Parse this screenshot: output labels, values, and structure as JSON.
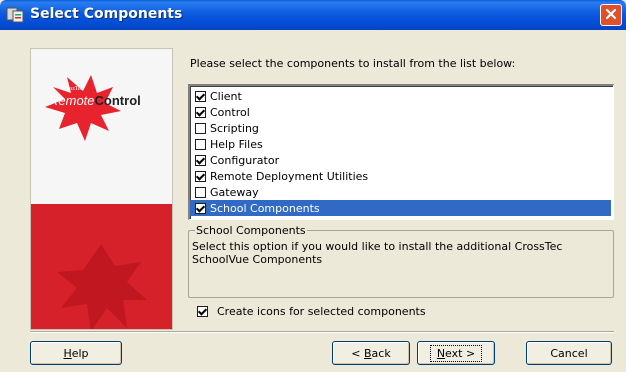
{
  "window": {
    "title": "Select Components",
    "close_icon": "close-icon"
  },
  "banner": {
    "logo_small": "CrossTec",
    "logo_remote": "Remote",
    "logo_control": "Control",
    "colors": {
      "red": "#d6212b",
      "star": "#e8232d"
    }
  },
  "instruction": "Please select the components to install from the list below:",
  "components": [
    {
      "label": "Client",
      "checked": true,
      "selected": false
    },
    {
      "label": "Control",
      "checked": true,
      "selected": false
    },
    {
      "label": "Scripting",
      "checked": false,
      "selected": false
    },
    {
      "label": "Help Files",
      "checked": false,
      "selected": false
    },
    {
      "label": "Configurator",
      "checked": true,
      "selected": false
    },
    {
      "label": "Remote Deployment Utilities",
      "checked": true,
      "selected": false
    },
    {
      "label": "Gateway",
      "checked": false,
      "selected": false
    },
    {
      "label": "School Components",
      "checked": true,
      "selected": true
    }
  ],
  "description": {
    "title": "School Components",
    "text": "Select this option if you would like to install the additional CrossTec SchoolVue Components"
  },
  "create_icons": {
    "label": "Create icons for selected components",
    "checked": true
  },
  "buttons": {
    "help": {
      "pre": "",
      "u": "H",
      "post": "elp"
    },
    "back": {
      "pre": "< ",
      "u": "B",
      "post": "ack"
    },
    "next": {
      "pre": "",
      "u": "N",
      "post": "ext >"
    },
    "cancel": "Cancel"
  },
  "colors": {
    "titlebar": "#0450d6",
    "selection": "#316ac5",
    "dialog_bg": "#ece9d8"
  }
}
